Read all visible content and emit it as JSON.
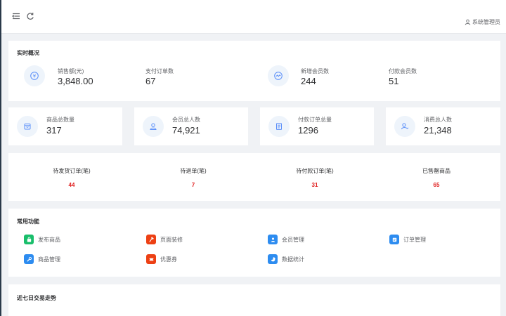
{
  "header": {
    "username": "系统管理员"
  },
  "realtime": {
    "title": "实时概况",
    "stats": [
      {
        "label": "销售额(元)",
        "value": "3,848.00",
        "icon": "yen-icon"
      },
      {
        "label": "支付订单数",
        "value": "67"
      },
      {
        "label": "新增会员数",
        "value": "244",
        "icon": "trend-icon"
      },
      {
        "label": "付款会员数",
        "value": "51"
      }
    ]
  },
  "summary": [
    {
      "label": "商品总数量",
      "value": "317",
      "icon": "product-box-icon"
    },
    {
      "label": "会员总人数",
      "value": "74,921",
      "icon": "member-user-icon"
    },
    {
      "label": "付款订单总量",
      "value": "1296",
      "icon": "order-list-icon"
    },
    {
      "label": "消费总人数",
      "value": "21,348",
      "icon": "consumer-icon"
    }
  ],
  "orders": [
    {
      "label": "待发货订单(笔)",
      "value": "44"
    },
    {
      "label": "待退单(笔)",
      "value": "7"
    },
    {
      "label": "待付款订单(笔)",
      "value": "31"
    },
    {
      "label": "已售罄商品",
      "value": "65"
    }
  ],
  "functions": {
    "title": "常用功能",
    "items": [
      {
        "label": "发布商品",
        "icon": "publish-bag-icon",
        "color": "#19be6b"
      },
      {
        "label": "页面装修",
        "icon": "decorate-hammer-icon",
        "color": "#ed4014"
      },
      {
        "label": "会员管理",
        "icon": "member-manage-icon",
        "color": "#2d8cf0"
      },
      {
        "label": "订单管理",
        "icon": "order-manage-icon",
        "color": "#2d8cf0"
      },
      {
        "label": "商品管理",
        "icon": "wrench-icon",
        "color": "#2d8cf0"
      },
      {
        "label": "优惠券",
        "icon": "coupon-icon",
        "color": "#ed4014"
      },
      {
        "label": "数据统计",
        "icon": "pie-chart-icon",
        "color": "#2d8cf0"
      }
    ]
  },
  "trend": {
    "title": "近七日交易走势"
  }
}
